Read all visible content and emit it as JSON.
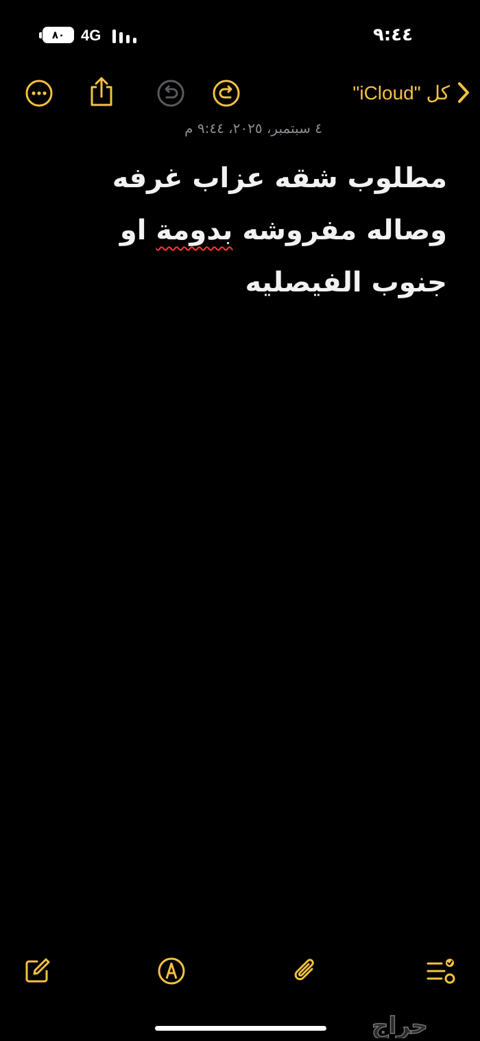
{
  "status_bar": {
    "time": "٩:٤٤",
    "battery_level": "٨٠",
    "network": "4G"
  },
  "toolbar": {
    "back_label": "كل \"iCloud\"",
    "icons": [
      "more-icon",
      "share-icon",
      "undo-icon",
      "redo-icon",
      "chevron-right-icon"
    ]
  },
  "note": {
    "date": "٤ سبتمبر، ٢٠٢٥، ٩:٤٤ م",
    "lines": [
      "مطلوب شقه عزاب غرفه",
      "وصاله مفروشه",
      "او",
      "جنوب الفيصليه"
    ],
    "misspelled_word": "بدومة"
  },
  "bottom_toolbar": {
    "icons": [
      "compose-icon",
      "markup-icon",
      "attachment-icon",
      "checklist-icon"
    ]
  },
  "watermark": {
    "text": "حراج"
  },
  "colors": {
    "accent": "#f5c242",
    "background": "#000000",
    "text": "#f2f2f2",
    "secondary_text": "#8e8e93",
    "disabled_icon": "#5a5a5e",
    "spellcheck": "#ff3b30"
  }
}
